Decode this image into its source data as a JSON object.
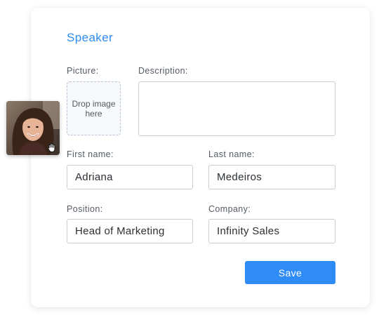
{
  "form": {
    "title": "Speaker",
    "picture_label": "Picture:",
    "dropzone_text": "Drop image here",
    "description_label": "Description:",
    "description_value": "",
    "first_name_label": "First name:",
    "first_name_value": "Adriana",
    "last_name_label": "Last name:",
    "last_name_value": "Medeiros",
    "position_label": "Position:",
    "position_value": "Head of Marketing",
    "company_label": "Company:",
    "company_value": "Infinity Sales",
    "save_label": "Save"
  },
  "dragged_image": {
    "icon": "grab-hand-icon"
  },
  "colors": {
    "accent": "#2f8cf7",
    "title": "#2e8cf0",
    "label": "#555b63",
    "border": "#c9ccd1"
  }
}
